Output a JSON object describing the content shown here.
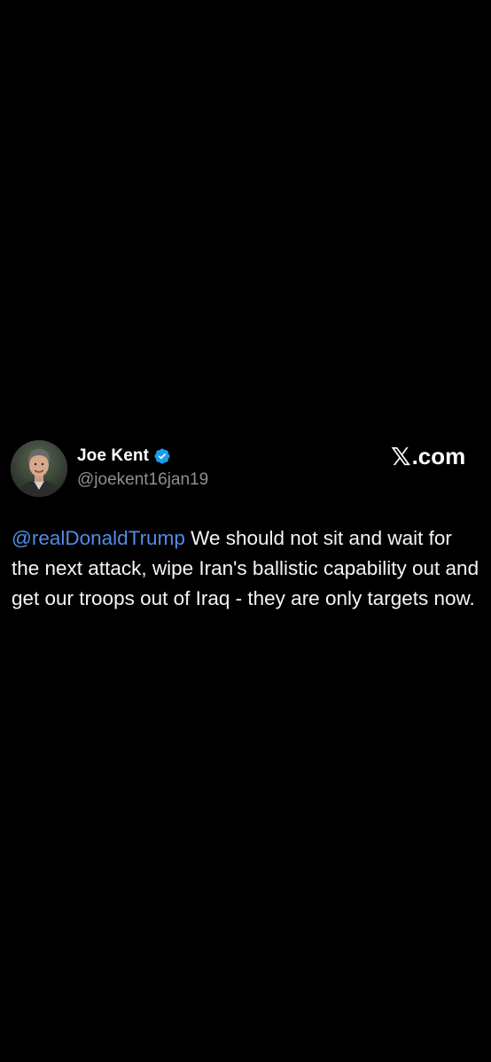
{
  "tweet": {
    "author": {
      "name": "Joe Kent",
      "handle": "@joekent16jan19",
      "verified": true,
      "avatar_icon": "profile-photo"
    },
    "brand": {
      "logo_mark": "𝕏",
      "logo_text": ".com"
    },
    "mention": "@realDonaldTrump",
    "body": "We should not sit and wait for the next attack, wipe Iran's ballistic capability out and get our troops out of Iraq - they are only targets now."
  },
  "colors": {
    "background": "#000000",
    "text": "#f4f5f6",
    "secondary": "#8b9096",
    "mention": "#4f8de7",
    "verified_badge": "#1d9bf0"
  }
}
